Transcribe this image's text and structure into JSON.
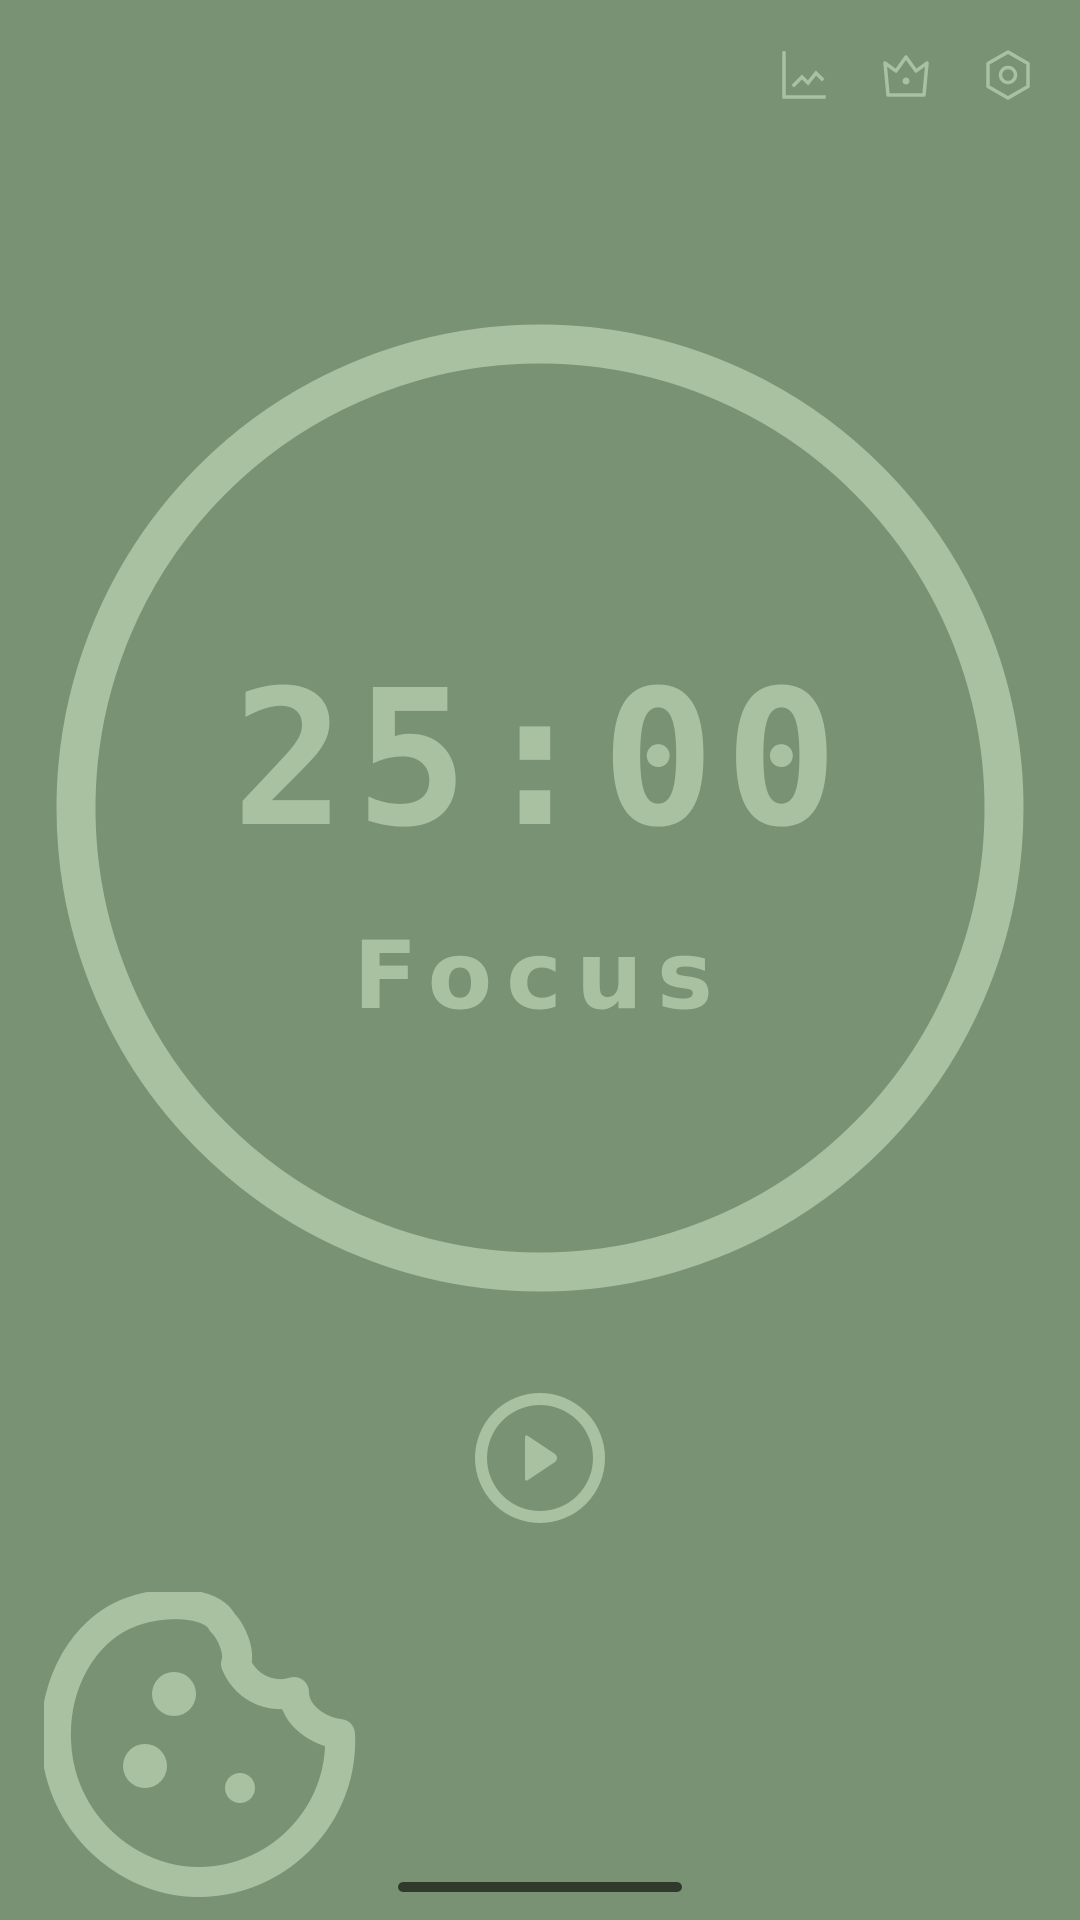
{
  "colors": {
    "background": "#7a9274",
    "accent": "#a9c0a1",
    "home_indicator": "#2f3a2c"
  },
  "toolbar": {
    "icons": [
      "stats-chart-icon",
      "crown-icon",
      "settings-hexagon-icon"
    ]
  },
  "timer": {
    "time": "25:00",
    "mode": "Focus",
    "progress": 1.0
  },
  "controls": {
    "play_icon": "play-icon"
  },
  "extras": {
    "cookie_icon": "cookie-icon"
  }
}
